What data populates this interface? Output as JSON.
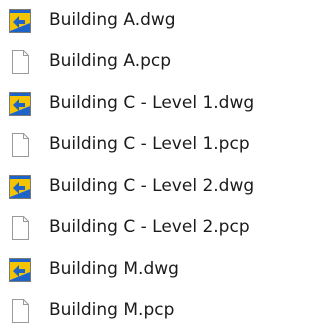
{
  "files": [
    {
      "name": "Building A.dwg",
      "icon": "dwg-file-icon"
    },
    {
      "name": "Building A.pcp",
      "icon": "blank-file-icon"
    },
    {
      "name": "Building C - Level 1.dwg",
      "icon": "dwg-file-icon"
    },
    {
      "name": "Building C - Level 1.pcp",
      "icon": "blank-file-icon"
    },
    {
      "name": "Building C - Level 2.dwg",
      "icon": "dwg-file-icon"
    },
    {
      "name": "Building C - Level 2.pcp",
      "icon": "blank-file-icon"
    },
    {
      "name": "Building M.dwg",
      "icon": "dwg-file-icon"
    },
    {
      "name": "Building M.pcp",
      "icon": "blank-file-icon"
    }
  ],
  "colors": {
    "text": "#1b1b1b",
    "dwg_blue": "#1e64c8",
    "dwg_yellow": "#f5c400",
    "page_outline": "#9a9a9a"
  }
}
